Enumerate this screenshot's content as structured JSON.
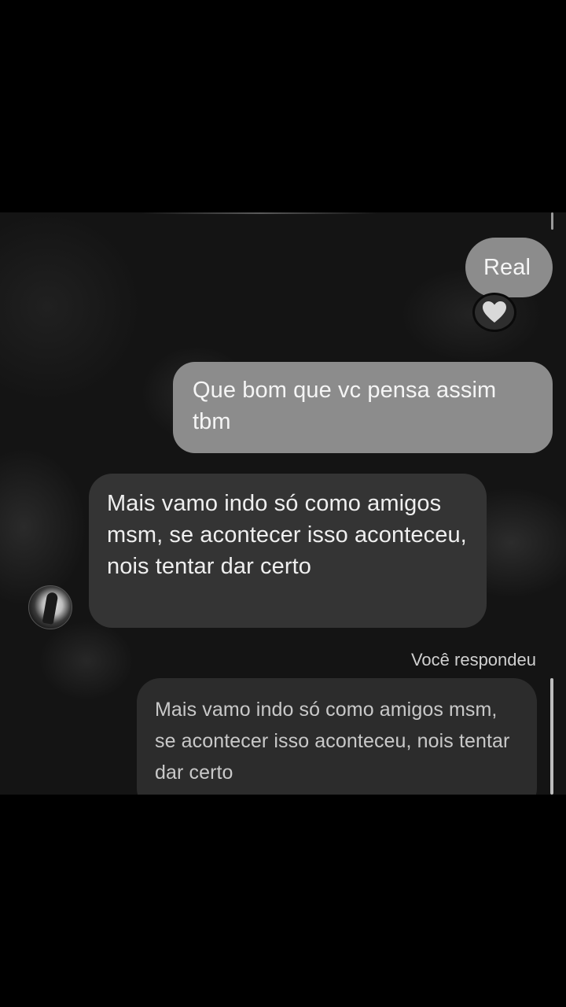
{
  "messages": [
    {
      "id": "msg-real",
      "sender": "me",
      "text": "Real",
      "reaction": "heart"
    },
    {
      "id": "msg-que",
      "sender": "me",
      "text": "Que bom que vc pensa assim tbm"
    },
    {
      "id": "msg-mais",
      "sender": "other",
      "text": "Mais vamo indo só como amigos msm, se acontecer isso aconteceu, nois tentar dar certo"
    }
  ],
  "reply": {
    "label": "Você respondeu",
    "quoted_text": "Mais vamo indo só como amigos msm, se acontecer isso aconteceu, nois tentar dar certo"
  },
  "icons": {
    "reaction": "heart-icon",
    "avatar": "contact-avatar"
  },
  "colors": {
    "sent_bubble": "#8c8c8c",
    "received_bubble": "#343434",
    "background": "#141414"
  }
}
